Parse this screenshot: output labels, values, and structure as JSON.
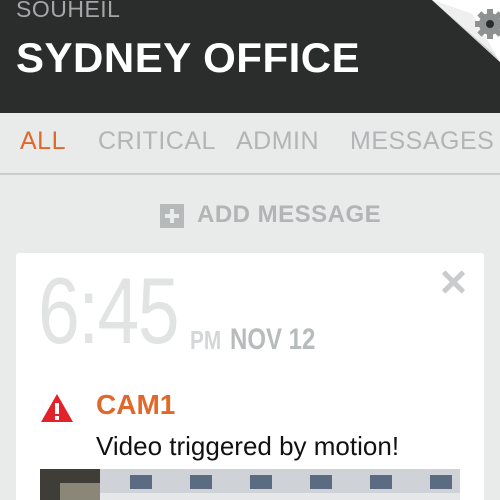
{
  "header": {
    "user": "SOUHEIL",
    "office": "SYDNEY OFFICE"
  },
  "tabs": [
    {
      "label": "ALL",
      "active": true
    },
    {
      "label": "CRITICAL",
      "active": false
    },
    {
      "label": "ADMIN",
      "active": false
    },
    {
      "label": "MESSAGES",
      "active": false
    }
  ],
  "add_message": {
    "label": "ADD MESSAGE"
  },
  "notification": {
    "time": "6:45",
    "ampm": "PM",
    "date": "NOV 12",
    "title": "CAM1",
    "message": "Video triggered by motion!"
  },
  "colors": {
    "accent": "#e0682a",
    "header_bg": "#2b2d2d",
    "page_bg": "#e9eaea",
    "warning": "#e2222b"
  },
  "icons": {
    "settings": "gear-icon",
    "add": "plus-square-icon",
    "close": "close-icon",
    "warning": "warning-triangle-icon"
  }
}
